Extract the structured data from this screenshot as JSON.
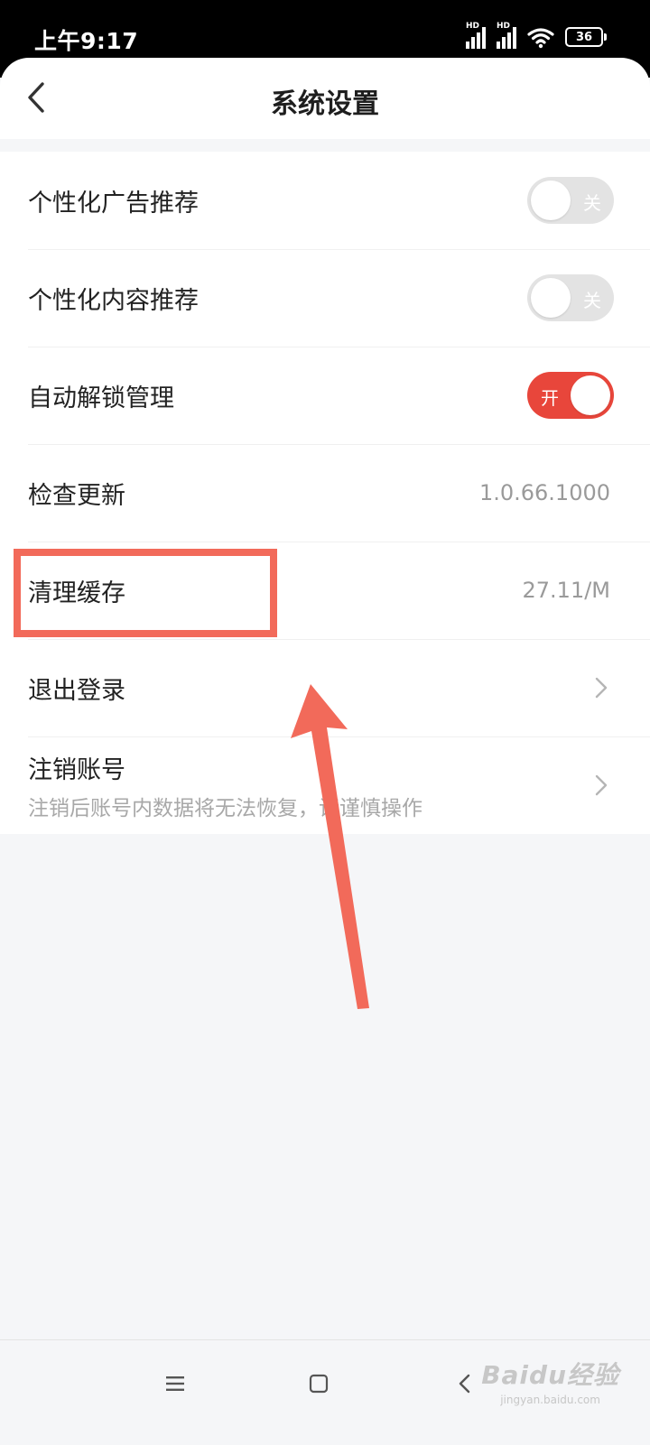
{
  "status_bar": {
    "time": "上午9:17",
    "signal_1_label": "HD",
    "signal_2_label": "HD",
    "battery_level": "36"
  },
  "header": {
    "title": "系统设置",
    "back_icon": "chevron-left-icon"
  },
  "settings": {
    "ad_recommend": {
      "label": "个性化广告推荐",
      "toggle_text": "关",
      "enabled": false
    },
    "content_recommend": {
      "label": "个性化内容推荐",
      "toggle_text": "关",
      "enabled": false
    },
    "auto_unlock": {
      "label": "自动解锁管理",
      "toggle_text": "开",
      "enabled": true
    },
    "check_update": {
      "label": "检查更新",
      "value": "1.0.66.1000"
    },
    "clear_cache": {
      "label": "清理缓存",
      "value": "27.11/M"
    },
    "logout": {
      "label": "退出登录",
      "icon": "chevron-right-icon"
    },
    "deactivate": {
      "label": "注销账号",
      "sub": "注销后账号内数据将无法恢复，请谨慎操作",
      "icon": "chevron-right-icon"
    }
  },
  "nav_bar": {
    "menu_icon": "menu-icon",
    "home_icon": "home-square-icon",
    "back_icon": "back-triangle-icon"
  },
  "watermark": {
    "main": "Baidu经验",
    "sub": "jingyan.baidu.com"
  },
  "colors": {
    "toggle_on": "#e8463b",
    "toggle_off": "#e3e3e3",
    "annotation": "#f26a5a"
  }
}
